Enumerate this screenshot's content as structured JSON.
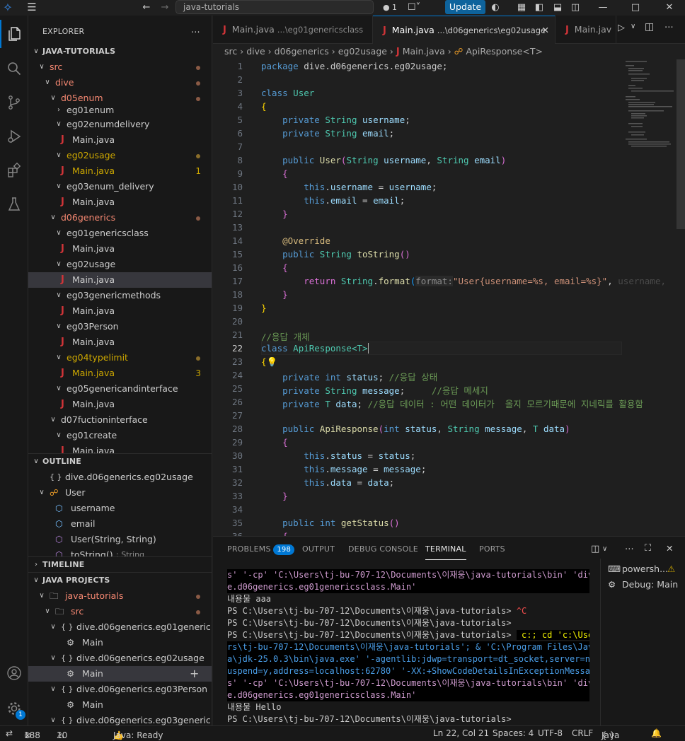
{
  "title_bar": {
    "search": "java-tutorials",
    "update_label": "Update",
    "notif_count": "1"
  },
  "explorer": {
    "header": "EXPLORER",
    "project": "JAVA-TUTORIALS",
    "items": [
      {
        "label": "src"
      },
      {
        "label": "dive"
      },
      {
        "label": "d05enum"
      },
      {
        "label": "eg01enum"
      },
      {
        "label": "eg02enumdelivery"
      },
      {
        "label": "Main.java"
      },
      {
        "label": "eg02usage"
      },
      {
        "label": "Main.java",
        "count": "1"
      },
      {
        "label": "eg03enum_delivery"
      },
      {
        "label": "Main.java"
      },
      {
        "label": "d06generics"
      },
      {
        "label": "eg01genericsclass"
      },
      {
        "label": "Main.java"
      },
      {
        "label": "eg02usage"
      },
      {
        "label": "Main.java"
      },
      {
        "label": "eg03genericmethods"
      },
      {
        "label": "Main.java"
      },
      {
        "label": "eg03Person"
      },
      {
        "label": "Main.java"
      },
      {
        "label": "eg04typelimit"
      },
      {
        "label": "Main.java",
        "count": "3"
      },
      {
        "label": "eg05genericandinterface"
      },
      {
        "label": "Main.java"
      },
      {
        "label": "d07fuctioninterface"
      },
      {
        "label": "eg01create"
      },
      {
        "label": "Main.java"
      }
    ]
  },
  "outline": {
    "header": "OUTLINE",
    "items": [
      {
        "label": "dive.d06generics.eg02usage"
      },
      {
        "label": "User"
      },
      {
        "label": "username"
      },
      {
        "label": "email"
      },
      {
        "label": "User(String, String)"
      },
      {
        "label": "toString()",
        "detail": ": String"
      }
    ]
  },
  "timeline": {
    "header": "TIMELINE"
  },
  "java_projects": {
    "header": "JAVA PROJECTS",
    "items": [
      {
        "label": "java-tutorials"
      },
      {
        "label": "src"
      },
      {
        "label": "dive.d06generics.eg01generic..."
      },
      {
        "label": "Main"
      },
      {
        "label": "dive.d06generics.eg02usage"
      },
      {
        "label": "Main"
      },
      {
        "label": "dive.d06generics.eg03Person"
      },
      {
        "label": "Main"
      },
      {
        "label": "dive.d06generics.eg03generic..."
      }
    ]
  },
  "tabs": [
    {
      "name": "Main.java",
      "desc": "...\\eg01genericsclass"
    },
    {
      "name": "Main.java",
      "desc": "...\\d06generics\\eg02usage"
    },
    {
      "name": "Main.jav"
    }
  ],
  "breadcrumb": [
    "src",
    "dive",
    "d06generics",
    "eg02usage",
    "Main.java",
    "ApiResponse<T>"
  ],
  "line_numbers": [
    "1",
    "2",
    "3",
    "4",
    "5",
    "6",
    "7",
    "8",
    "9",
    "10",
    "11",
    "12",
    "13",
    "14",
    "15",
    "16",
    "17",
    "18",
    "19",
    "20",
    "21",
    "22",
    "23",
    "24",
    "25",
    "26",
    "27",
    "28",
    "29",
    "30",
    "31",
    "32",
    "33",
    "34",
    "35",
    "36"
  ],
  "code": {
    "l1_kw": "package",
    "l1_rest": " dive.d06generics.eg02usage;",
    "l3_kw": "class",
    "l3_name": "User",
    "brace_open": "{",
    "brace_close": "}",
    "private": "private",
    "public": "public",
    "return": "return",
    "this": "this",
    "int": "int",
    "string": "String",
    "username": "username",
    "email": "email",
    "status": "status",
    "message": "message",
    "data": "data",
    "l10_c": "username",
    "l11_c": "email",
    "override": "@Override",
    "to_string": "toString",
    "user_ctor": "User",
    "format_call": "format",
    "param_hint": "format:",
    "format_str": "\"User{username=%s, email=%s}\"",
    "format_tail": "username,",
    "comment_resp": "//응답 개체",
    "class_kw": "class",
    "api_resp": "ApiResponse",
    "generic_t": "<T>",
    "t_type": "T",
    "c24": "//응답 상태",
    "c25": "//응답 메세지",
    "c26": "//응답 데이터 : 어떤 데이터가  올지 모르기때문에 지네릭를 활용함",
    "get_status": "getStatus"
  },
  "panel": {
    "tabs": [
      "PROBLEMS",
      "OUTPUT",
      "DEBUG CONSOLE",
      "TERMINAL",
      "PORTS"
    ],
    "problems_count": "198",
    "terminals": [
      "powersh...",
      "Debug: Main"
    ]
  },
  "terminal_lines": {
    "a1": "s' '-cp' 'C:\\Users\\tj-bu-707-12\\Documents\\이재웅\\java-tutorials\\bin' 'div",
    "a2": "e.d06generics.eg01genericsclass.Main'",
    "a3": "내용물 aaa",
    "a4": "PS C:\\Users\\tj-bu-707-12\\Documents\\이재웅\\java-tutorials> ",
    "a4c": "^C",
    "a5": "PS C:\\Users\\tj-bu-707-12\\Documents\\이재웅\\java-tutorials>",
    "a6": "PS C:\\Users\\tj-bu-707-12\\Documents\\이재웅\\java-tutorials> ",
    "a6b": " c:; cd 'c:\\Use",
    "a7": "rs\\tj-bu-707-12\\Documents\\이재웅\\java-tutorials'; & 'C:\\Program Files\\Jav",
    "a8": "a\\jdk-25.0.3\\bin\\java.exe' '-agentlib:jdwp=transport=dt_socket,server=n,s",
    "a9": "uspend=y,address=localhost:62780' '-XX:+ShowCodeDetailsInExceptionMessage",
    "a10": "s' '-cp' 'C:\\Users\\tj-bu-707-12\\Documents\\이재웅\\java-tutorials\\bin' 'div",
    "a11": "e.d06generics.eg01genericsclass.Main'",
    "a12": "내용물 Hello",
    "a13": "PS C:\\Users\\tj-bu-707-12\\Documents\\이재웅\\java-tutorials>"
  },
  "status_bar": {
    "errors": "188",
    "warnings": "10",
    "java_status": "Java: Ready",
    "position": "Ln 22, Col 21",
    "spaces": "Spaces: 4",
    "encoding": "UTF-8",
    "eol": "CRLF",
    "language": "Java",
    "settings_badge": "1"
  },
  "colors": {
    "accent": "#0078d4",
    "update": "#0e639c",
    "error": "#d13438",
    "modified": "#cca700"
  }
}
